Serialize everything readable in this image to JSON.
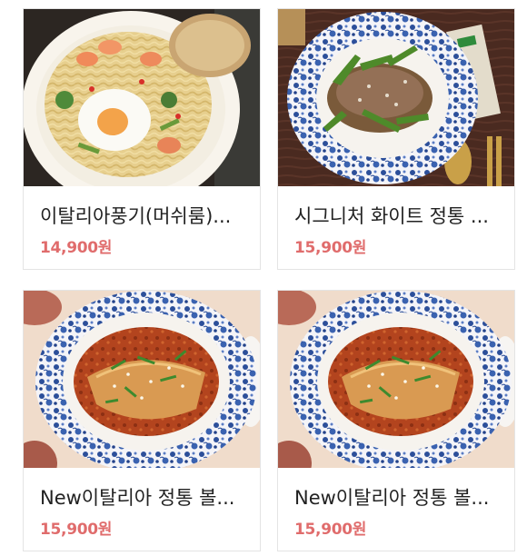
{
  "products": [
    {
      "name": "이탈리아풍기(머쉬룸)...",
      "price": "14,900원",
      "photo": "shrimp-cream-pasta-with-fried-egg"
    },
    {
      "name": "시그니처 화이트 정통 ...",
      "price": "15,900원",
      "photo": "risotto-with-arugula-on-blue-plate"
    },
    {
      "name": "New이탈리아 정통 볼...",
      "price": "15,900원",
      "photo": "bolognese-lasagna-on-blue-plate"
    },
    {
      "name": "New이탈리아 정통 볼...",
      "price": "15,900원",
      "photo": "bolognese-lasagna-on-blue-plate"
    }
  ],
  "colors": {
    "price": "#e06c6c",
    "name": "#222222",
    "card_border": "#e4e4e4"
  }
}
